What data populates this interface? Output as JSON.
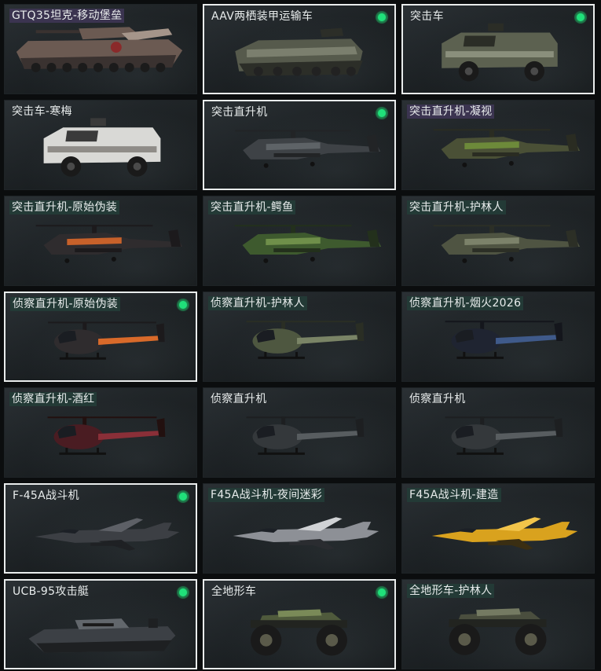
{
  "vehicles": [
    {
      "name": "GTQ35坦克-移动堡垒",
      "kind": "tank",
      "tag": "violet",
      "selected": false,
      "owned": false,
      "colors": [
        "#6b5a52",
        "#a5958a",
        "#3a3230"
      ]
    },
    {
      "name": "AAV两栖装甲运输车",
      "kind": "amphibious",
      "tag": "none",
      "selected": true,
      "owned": true,
      "colors": [
        "#565a4c",
        "#7b7f6e",
        "#2c2e28"
      ]
    },
    {
      "name": "突击车",
      "kind": "armored",
      "tag": "none",
      "selected": true,
      "owned": true,
      "colors": [
        "#5c6150",
        "#8a8f7c",
        "#2b2d26"
      ]
    },
    {
      "name": "突击车-寒梅",
      "kind": "armored",
      "tag": "none",
      "selected": false,
      "owned": false,
      "colors": [
        "#d9d9d6",
        "#8f8c88",
        "#3a3a3a"
      ]
    },
    {
      "name": "突击直升机",
      "kind": "attack-heli",
      "tag": "none",
      "selected": true,
      "owned": true,
      "colors": [
        "#3e4246",
        "#5e6367",
        "#222426"
      ]
    },
    {
      "name": "突击直升机-凝视",
      "kind": "attack-heli",
      "tag": "violet",
      "selected": false,
      "owned": false,
      "colors": [
        "#4a5036",
        "#6d8a3a",
        "#2a2c22"
      ]
    },
    {
      "name": "突击直升机-原始伪装",
      "kind": "attack-heli",
      "tag": "teal",
      "selected": false,
      "owned": false,
      "colors": [
        "#2f2c2e",
        "#c7612a",
        "#1c1a1c"
      ]
    },
    {
      "name": "突击直升机-鳄鱼",
      "kind": "attack-heli",
      "tag": "teal",
      "selected": false,
      "owned": false,
      "colors": [
        "#3e5a2e",
        "#6f8f4a",
        "#23301c"
      ]
    },
    {
      "name": "突击直升机-护林人",
      "kind": "attack-heli",
      "tag": "teal",
      "selected": false,
      "owned": false,
      "colors": [
        "#4f5442",
        "#7c826a",
        "#2c2f26"
      ]
    },
    {
      "name": "侦察直升机-原始伪装",
      "kind": "scout-heli",
      "tag": "teal",
      "selected": true,
      "owned": true,
      "colors": [
        "#2f2c2e",
        "#d86a2a",
        "#1c1a1c"
      ]
    },
    {
      "name": "侦察直升机-护林人",
      "kind": "scout-heli",
      "tag": "teal",
      "selected": false,
      "owned": false,
      "colors": [
        "#4e5740",
        "#7a8466",
        "#2a2e24"
      ]
    },
    {
      "name": "侦察直升机-烟火2026",
      "kind": "scout-heli",
      "tag": "teal",
      "selected": false,
      "owned": false,
      "colors": [
        "#1f2431",
        "#3f5a8a",
        "#14161c"
      ]
    },
    {
      "name": "侦察直升机-酒红",
      "kind": "scout-heli",
      "tag": "teal",
      "selected": false,
      "owned": false,
      "colors": [
        "#4a1c22",
        "#8a2f38",
        "#22100f"
      ]
    },
    {
      "name": "侦察直升机",
      "kind": "scout-heli",
      "tag": "none",
      "selected": false,
      "owned": false,
      "colors": [
        "#34383b",
        "#585d60",
        "#1d1f21"
      ]
    },
    {
      "name": "侦察直升机",
      "kind": "scout-heli",
      "tag": "none",
      "selected": false,
      "owned": false,
      "colors": [
        "#34383b",
        "#585d60",
        "#1d1f21"
      ]
    },
    {
      "name": "F-45A战斗机",
      "kind": "jet",
      "tag": "none",
      "selected": true,
      "owned": true,
      "colors": [
        "#3c3f44",
        "#5d6066",
        "#1f2124"
      ]
    },
    {
      "name": "F45A战斗机-夜间迷彩",
      "kind": "jet",
      "tag": "teal",
      "selected": false,
      "owned": false,
      "colors": [
        "#8d9096",
        "#d0d2d5",
        "#2a2c30"
      ]
    },
    {
      "name": "F45A战斗机-建造",
      "kind": "jet",
      "tag": "teal",
      "selected": false,
      "owned": false,
      "colors": [
        "#d9a21e",
        "#f2c44a",
        "#3a2e12"
      ]
    },
    {
      "name": "UCB-95攻击艇",
      "kind": "boat",
      "tag": "none",
      "selected": true,
      "owned": true,
      "colors": [
        "#3c4045",
        "#62676c",
        "#1e2022"
      ]
    },
    {
      "name": "全地形车",
      "kind": "atv",
      "tag": "none",
      "selected": true,
      "owned": true,
      "colors": [
        "#4f5a3c",
        "#7a8a58",
        "#222420"
      ]
    },
    {
      "name": "全地形车-护林人",
      "kind": "atv",
      "tag": "teal",
      "selected": false,
      "owned": false,
      "colors": [
        "#4a4e3e",
        "#747a62",
        "#222420"
      ]
    }
  ]
}
